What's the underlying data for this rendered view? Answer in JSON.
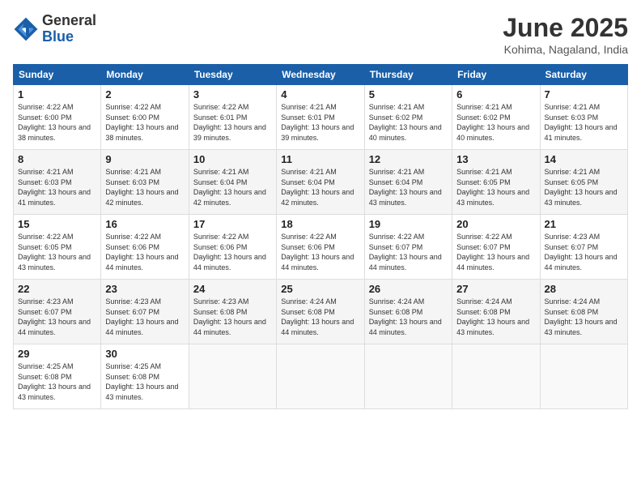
{
  "header": {
    "logo": {
      "general": "General",
      "blue": "Blue"
    },
    "title": "June 2025",
    "location": "Kohima, Nagaland, India"
  },
  "calendar": {
    "days_of_week": [
      "Sunday",
      "Monday",
      "Tuesday",
      "Wednesday",
      "Thursday",
      "Friday",
      "Saturday"
    ],
    "weeks": [
      [
        null,
        {
          "day": "2",
          "sunrise": "4:22 AM",
          "sunset": "6:00 PM",
          "daylight": "13 hours and 38 minutes."
        },
        {
          "day": "3",
          "sunrise": "4:22 AM",
          "sunset": "6:01 PM",
          "daylight": "13 hours and 39 minutes."
        },
        {
          "day": "4",
          "sunrise": "4:21 AM",
          "sunset": "6:01 PM",
          "daylight": "13 hours and 39 minutes."
        },
        {
          "day": "5",
          "sunrise": "4:21 AM",
          "sunset": "6:02 PM",
          "daylight": "13 hours and 40 minutes."
        },
        {
          "day": "6",
          "sunrise": "4:21 AM",
          "sunset": "6:02 PM",
          "daylight": "13 hours and 40 minutes."
        },
        {
          "day": "7",
          "sunrise": "4:21 AM",
          "sunset": "6:03 PM",
          "daylight": "13 hours and 41 minutes."
        }
      ],
      [
        {
          "day": "1",
          "sunrise": "4:22 AM",
          "sunset": "6:00 PM",
          "daylight": "13 hours and 38 minutes.",
          "row0": true
        },
        {
          "day": "8",
          "sunrise": "4:21 AM",
          "sunset": "6:03 PM",
          "daylight": "13 hours and 41 minutes."
        },
        {
          "day": "9",
          "sunrise": "4:21 AM",
          "sunset": "6:03 PM",
          "daylight": "13 hours and 42 minutes."
        },
        {
          "day": "10",
          "sunrise": "4:21 AM",
          "sunset": "6:04 PM",
          "daylight": "13 hours and 42 minutes."
        },
        {
          "day": "11",
          "sunrise": "4:21 AM",
          "sunset": "6:04 PM",
          "daylight": "13 hours and 42 minutes."
        },
        {
          "day": "12",
          "sunrise": "4:21 AM",
          "sunset": "6:04 PM",
          "daylight": "13 hours and 43 minutes."
        },
        {
          "day": "13",
          "sunrise": "4:21 AM",
          "sunset": "6:05 PM",
          "daylight": "13 hours and 43 minutes."
        },
        {
          "day": "14",
          "sunrise": "4:21 AM",
          "sunset": "6:05 PM",
          "daylight": "13 hours and 43 minutes."
        }
      ],
      [
        {
          "day": "15",
          "sunrise": "4:22 AM",
          "sunset": "6:05 PM",
          "daylight": "13 hours and 43 minutes."
        },
        {
          "day": "16",
          "sunrise": "4:22 AM",
          "sunset": "6:06 PM",
          "daylight": "13 hours and 44 minutes."
        },
        {
          "day": "17",
          "sunrise": "4:22 AM",
          "sunset": "6:06 PM",
          "daylight": "13 hours and 44 minutes."
        },
        {
          "day": "18",
          "sunrise": "4:22 AM",
          "sunset": "6:06 PM",
          "daylight": "13 hours and 44 minutes."
        },
        {
          "day": "19",
          "sunrise": "4:22 AM",
          "sunset": "6:07 PM",
          "daylight": "13 hours and 44 minutes."
        },
        {
          "day": "20",
          "sunrise": "4:22 AM",
          "sunset": "6:07 PM",
          "daylight": "13 hours and 44 minutes."
        },
        {
          "day": "21",
          "sunrise": "4:23 AM",
          "sunset": "6:07 PM",
          "daylight": "13 hours and 44 minutes."
        }
      ],
      [
        {
          "day": "22",
          "sunrise": "4:23 AM",
          "sunset": "6:07 PM",
          "daylight": "13 hours and 44 minutes."
        },
        {
          "day": "23",
          "sunrise": "4:23 AM",
          "sunset": "6:07 PM",
          "daylight": "13 hours and 44 minutes."
        },
        {
          "day": "24",
          "sunrise": "4:23 AM",
          "sunset": "6:08 PM",
          "daylight": "13 hours and 44 minutes."
        },
        {
          "day": "25",
          "sunrise": "4:24 AM",
          "sunset": "6:08 PM",
          "daylight": "13 hours and 44 minutes."
        },
        {
          "day": "26",
          "sunrise": "4:24 AM",
          "sunset": "6:08 PM",
          "daylight": "13 hours and 44 minutes."
        },
        {
          "day": "27",
          "sunrise": "4:24 AM",
          "sunset": "6:08 PM",
          "daylight": "13 hours and 43 minutes."
        },
        {
          "day": "28",
          "sunrise": "4:24 AM",
          "sunset": "6:08 PM",
          "daylight": "13 hours and 43 minutes."
        }
      ],
      [
        {
          "day": "29",
          "sunrise": "4:25 AM",
          "sunset": "6:08 PM",
          "daylight": "13 hours and 43 minutes."
        },
        {
          "day": "30",
          "sunrise": "4:25 AM",
          "sunset": "6:08 PM",
          "daylight": "13 hours and 43 minutes."
        },
        null,
        null,
        null,
        null,
        null
      ]
    ]
  }
}
